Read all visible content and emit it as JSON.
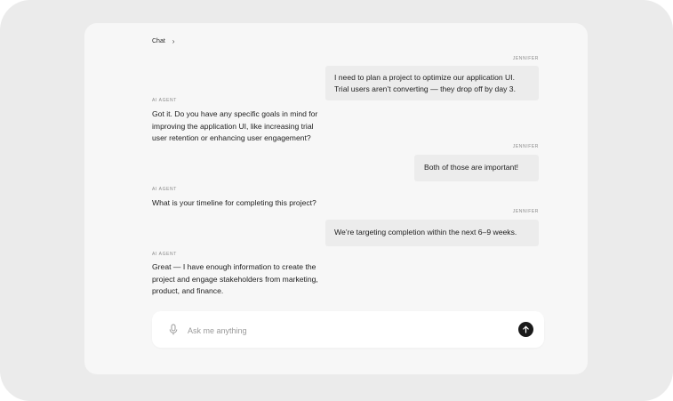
{
  "breadcrumb": {
    "label": "Chat",
    "chevron_icon": "chevron-right-icon"
  },
  "messages": [
    {
      "sender": "JENNIFER",
      "role": "user",
      "lines": [
        "I need to plan a project to optimize our application UI.",
        "Trial users aren’t converting — they drop off by day 3."
      ]
    },
    {
      "sender": "AI AGENT",
      "role": "agent",
      "lines": [
        "Got it. Do you have any specific goals in mind for",
        "improving the application UI, like increasing trial",
        "user retention or enhancing user engagement?"
      ]
    },
    {
      "sender": "JENNIFER",
      "role": "user",
      "lines": [
        "Both of those are important!"
      ]
    },
    {
      "sender": "AI AGENT",
      "role": "agent",
      "lines": [
        "What is your timeline for completing this project?"
      ]
    },
    {
      "sender": "JENNIFER",
      "role": "user",
      "lines": [
        "We’re targeting completion within the next 6–9 weeks."
      ]
    },
    {
      "sender": "AI AGENT",
      "role": "agent",
      "lines": [
        "Great — I have enough information to create the",
        "project and engage stakeholders from marketing,",
        "product, and finance."
      ]
    }
  ],
  "composer": {
    "placeholder": "Ask me anything",
    "value": "",
    "mic_icon": "microphone-icon",
    "send_icon": "arrow-up-icon"
  },
  "colors": {
    "outer_background": "#ebebeb",
    "card_background": "#f7f7f7",
    "user_bubble": "#ececec",
    "send_button": "#1a1a1a"
  }
}
